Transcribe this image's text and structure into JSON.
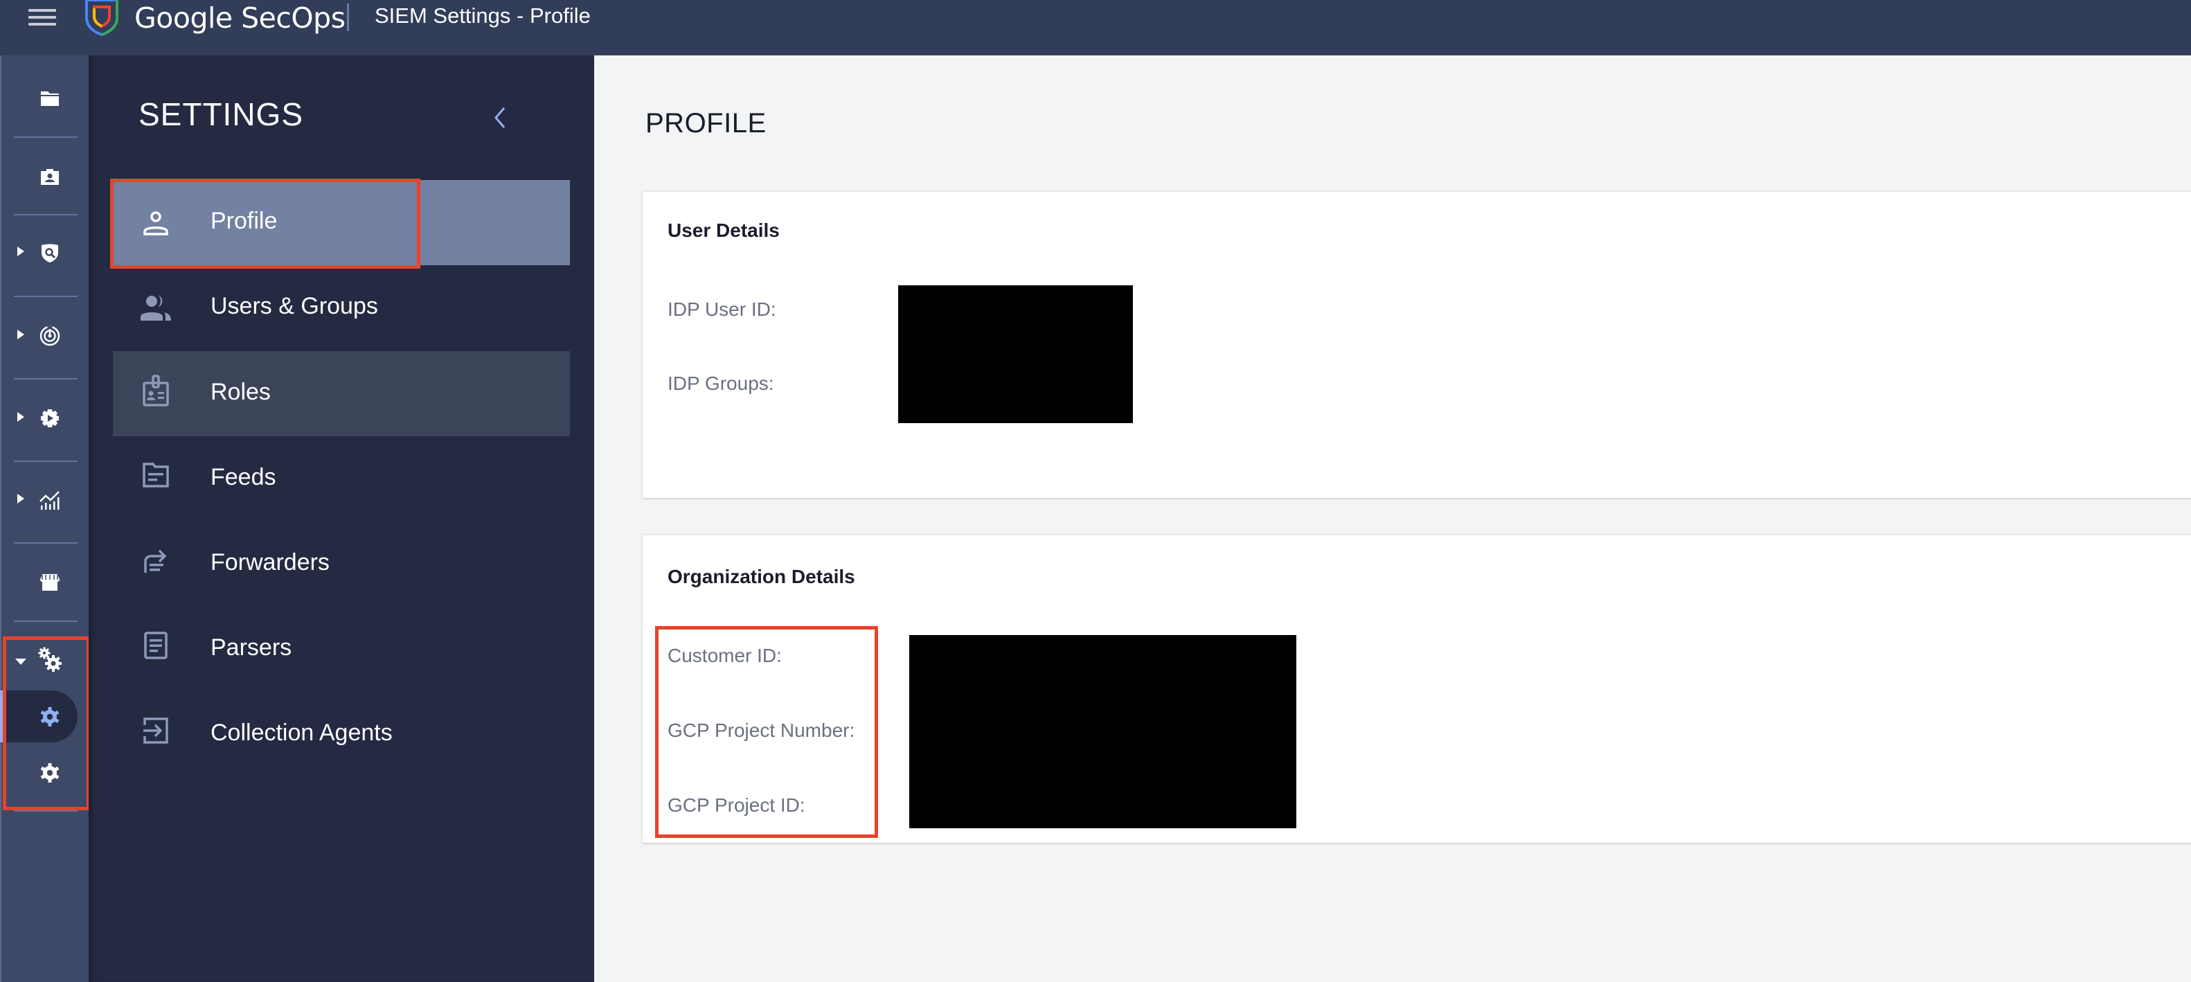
{
  "header": {
    "brand": "Google SecOps",
    "page_title": "SIEM Settings - Profile",
    "menu_icon": "hamburger-menu-icon",
    "logo_icon": "secops-shield-logo"
  },
  "rail": {
    "items": [
      {
        "icon": "folder-icon",
        "expandable": false
      },
      {
        "icon": "contact-card-icon",
        "expandable": false
      },
      {
        "icon": "shield-search-icon",
        "expandable": true
      },
      {
        "icon": "radar-icon",
        "expandable": true
      },
      {
        "icon": "gear-play-icon",
        "expandable": true
      },
      {
        "icon": "analytics-chart-icon",
        "expandable": true
      },
      {
        "icon": "storefront-icon",
        "expandable": false
      },
      {
        "icon": "settings-gears-icon",
        "expandable": true,
        "expanded": true,
        "children": [
          {
            "icon": "gear-icon",
            "active": true
          },
          {
            "icon": "gear-icon",
            "active": false
          }
        ]
      }
    ]
  },
  "settings_panel": {
    "title": "SETTINGS",
    "collapse_icon": "chevron-left-icon",
    "items": [
      {
        "label": "Profile",
        "icon": "person-icon",
        "active": true
      },
      {
        "label": "Users & Groups",
        "icon": "group-icon",
        "active": false
      },
      {
        "label": "Roles",
        "icon": "badge-icon",
        "active": false,
        "hovered": true
      },
      {
        "label": "Feeds",
        "icon": "feed-folder-icon",
        "active": false
      },
      {
        "label": "Forwarders",
        "icon": "forward-icon",
        "active": false
      },
      {
        "label": "Parsers",
        "icon": "document-icon",
        "active": false
      },
      {
        "label": "Collection Agents",
        "icon": "login-arrow-icon",
        "active": false
      }
    ]
  },
  "main": {
    "title": "PROFILE",
    "user_details": {
      "title": "User Details",
      "fields": [
        {
          "label": "IDP User ID:",
          "value": "[redacted]"
        },
        {
          "label": "IDP Groups:",
          "value": "[redacted]"
        }
      ]
    },
    "organization_details": {
      "title": "Organization Details",
      "fields": [
        {
          "label": "Customer ID:",
          "value": "[redacted]"
        },
        {
          "label": "GCP Project Number:",
          "value": "[redacted]"
        },
        {
          "label": "GCP Project ID:",
          "value": "[redacted]"
        }
      ]
    }
  },
  "colors": {
    "header_bg": "#323d59",
    "rail_bg": "#3d4966",
    "panel_bg": "#232a42",
    "active_item_bg": "#7381a2",
    "accent_blue": "#8fb0f2",
    "annotation_red": "#e8432b",
    "content_bg": "#f3f4f6"
  }
}
